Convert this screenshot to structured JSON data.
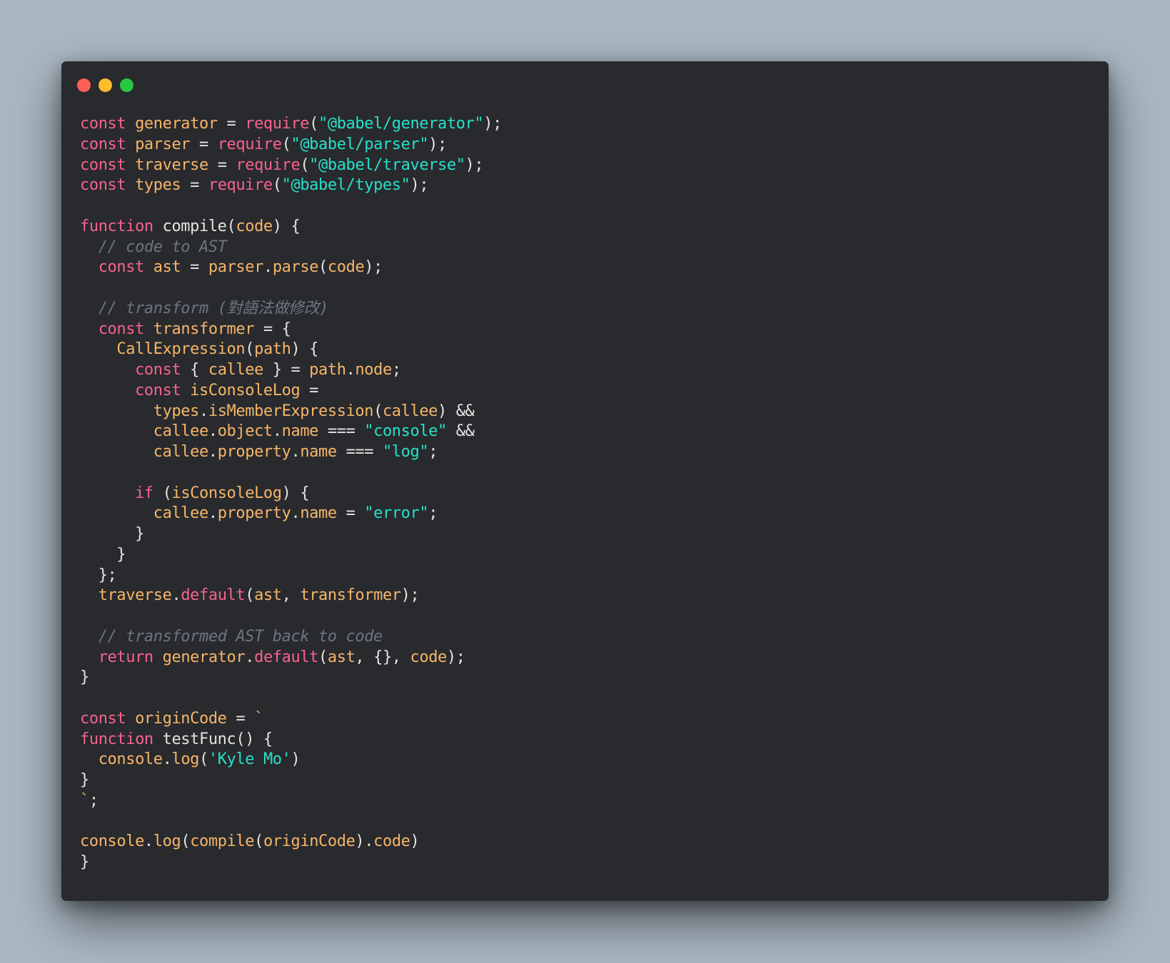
{
  "window": {
    "controls": [
      {
        "name": "close",
        "color": "#fd5f57"
      },
      {
        "name": "minimize",
        "color": "#febc2e"
      },
      {
        "name": "maximize",
        "color": "#28c840"
      }
    ]
  },
  "colors": {
    "background": "#abb8c3",
    "editor_background": "#282a2e",
    "keyword": "#f7628f",
    "identifier": "#f7b568",
    "string": "#27e0c9",
    "plain": "#e4e4e0",
    "comment": "#6e7480"
  },
  "code_lines": [
    [
      [
        "kw",
        "const "
      ],
      [
        "id",
        "generator"
      ],
      [
        "pl",
        " = "
      ],
      [
        "kw",
        "require"
      ],
      [
        "pl",
        "("
      ],
      [
        "str",
        "\"@babel/generator\""
      ],
      [
        "pl",
        ");"
      ]
    ],
    [
      [
        "kw",
        "const "
      ],
      [
        "id",
        "parser"
      ],
      [
        "pl",
        " = "
      ],
      [
        "kw",
        "require"
      ],
      [
        "pl",
        "("
      ],
      [
        "str",
        "\"@babel/parser\""
      ],
      [
        "pl",
        ");"
      ]
    ],
    [
      [
        "kw",
        "const "
      ],
      [
        "id",
        "traverse"
      ],
      [
        "pl",
        " = "
      ],
      [
        "kw",
        "require"
      ],
      [
        "pl",
        "("
      ],
      [
        "str",
        "\"@babel/traverse\""
      ],
      [
        "pl",
        ");"
      ]
    ],
    [
      [
        "kw",
        "const "
      ],
      [
        "id",
        "types"
      ],
      [
        "pl",
        " = "
      ],
      [
        "kw",
        "require"
      ],
      [
        "pl",
        "("
      ],
      [
        "str",
        "\"@babel/types\""
      ],
      [
        "pl",
        ");"
      ]
    ],
    [],
    [
      [
        "kw",
        "function "
      ],
      [
        "fn",
        "compile"
      ],
      [
        "pl",
        "("
      ],
      [
        "id",
        "code"
      ],
      [
        "pl",
        ") {"
      ]
    ],
    [
      [
        "pl",
        "  "
      ],
      [
        "cm",
        "// code to AST"
      ]
    ],
    [
      [
        "pl",
        "  "
      ],
      [
        "kw",
        "const "
      ],
      [
        "id",
        "ast"
      ],
      [
        "pl",
        " = "
      ],
      [
        "id",
        "parser"
      ],
      [
        "pl",
        "."
      ],
      [
        "id",
        "parse"
      ],
      [
        "pl",
        "("
      ],
      [
        "id",
        "code"
      ],
      [
        "pl",
        ");"
      ]
    ],
    [],
    [
      [
        "pl",
        "  "
      ],
      [
        "cm",
        "// transform (對語法做修改)"
      ]
    ],
    [
      [
        "pl",
        "  "
      ],
      [
        "kw",
        "const "
      ],
      [
        "id",
        "transformer"
      ],
      [
        "pl",
        " = {"
      ]
    ],
    [
      [
        "pl",
        "    "
      ],
      [
        "id",
        "CallExpression"
      ],
      [
        "pl",
        "("
      ],
      [
        "id",
        "path"
      ],
      [
        "pl",
        ") {"
      ]
    ],
    [
      [
        "pl",
        "      "
      ],
      [
        "kw",
        "const "
      ],
      [
        "pl",
        "{ "
      ],
      [
        "id",
        "callee"
      ],
      [
        "pl",
        " } = "
      ],
      [
        "id",
        "path"
      ],
      [
        "pl",
        "."
      ],
      [
        "id",
        "node"
      ],
      [
        "pl",
        ";"
      ]
    ],
    [
      [
        "pl",
        "      "
      ],
      [
        "kw",
        "const "
      ],
      [
        "id",
        "isConsoleLog"
      ],
      [
        "pl",
        " ="
      ]
    ],
    [
      [
        "pl",
        "        "
      ],
      [
        "id",
        "types"
      ],
      [
        "pl",
        "."
      ],
      [
        "id",
        "isMemberExpression"
      ],
      [
        "pl",
        "("
      ],
      [
        "id",
        "callee"
      ],
      [
        "pl",
        ") &&"
      ]
    ],
    [
      [
        "pl",
        "        "
      ],
      [
        "id",
        "callee"
      ],
      [
        "pl",
        "."
      ],
      [
        "id",
        "object"
      ],
      [
        "pl",
        "."
      ],
      [
        "id",
        "name"
      ],
      [
        "pl",
        " === "
      ],
      [
        "str",
        "\"console\""
      ],
      [
        "pl",
        " &&"
      ]
    ],
    [
      [
        "pl",
        "        "
      ],
      [
        "id",
        "callee"
      ],
      [
        "pl",
        "."
      ],
      [
        "id",
        "property"
      ],
      [
        "pl",
        "."
      ],
      [
        "id",
        "name"
      ],
      [
        "pl",
        " === "
      ],
      [
        "str",
        "\"log\""
      ],
      [
        "pl",
        ";"
      ]
    ],
    [],
    [
      [
        "pl",
        "      "
      ],
      [
        "kw",
        "if "
      ],
      [
        "pl",
        "("
      ],
      [
        "id",
        "isConsoleLog"
      ],
      [
        "pl",
        ") {"
      ]
    ],
    [
      [
        "pl",
        "        "
      ],
      [
        "id",
        "callee"
      ],
      [
        "pl",
        "."
      ],
      [
        "id",
        "property"
      ],
      [
        "pl",
        "."
      ],
      [
        "id",
        "name"
      ],
      [
        "pl",
        " = "
      ],
      [
        "str",
        "\"error\""
      ],
      [
        "pl",
        ";"
      ]
    ],
    [
      [
        "pl",
        "      }"
      ]
    ],
    [
      [
        "pl",
        "    }"
      ]
    ],
    [
      [
        "pl",
        "  };"
      ]
    ],
    [
      [
        "pl",
        "  "
      ],
      [
        "id",
        "traverse"
      ],
      [
        "pl",
        "."
      ],
      [
        "kw",
        "default"
      ],
      [
        "pl",
        "("
      ],
      [
        "id",
        "ast"
      ],
      [
        "pl",
        ", "
      ],
      [
        "id",
        "transformer"
      ],
      [
        "pl",
        ");"
      ]
    ],
    [],
    [
      [
        "pl",
        "  "
      ],
      [
        "cm",
        "// transformed AST back to code"
      ]
    ],
    [
      [
        "pl",
        "  "
      ],
      [
        "kw",
        "return "
      ],
      [
        "id",
        "generator"
      ],
      [
        "pl",
        "."
      ],
      [
        "kw",
        "default"
      ],
      [
        "pl",
        "("
      ],
      [
        "id",
        "ast"
      ],
      [
        "pl",
        ", {}, "
      ],
      [
        "id",
        "code"
      ],
      [
        "pl",
        ");"
      ]
    ],
    [
      [
        "pl",
        "}"
      ]
    ],
    [],
    [
      [
        "kw",
        "const "
      ],
      [
        "id",
        "originCode"
      ],
      [
        "pl",
        " = "
      ],
      [
        "id",
        "`"
      ]
    ],
    [
      [
        "kw",
        "function "
      ],
      [
        "fn",
        "testFunc"
      ],
      [
        "pl",
        "() {"
      ]
    ],
    [
      [
        "pl",
        "  "
      ],
      [
        "id",
        "console"
      ],
      [
        "pl",
        "."
      ],
      [
        "id",
        "log"
      ],
      [
        "pl",
        "("
      ],
      [
        "str",
        "'Kyle Mo'"
      ],
      [
        "pl",
        ")"
      ]
    ],
    [
      [
        "pl",
        "}"
      ]
    ],
    [
      [
        "id",
        "`"
      ],
      [
        "pl",
        ";"
      ]
    ],
    [],
    [
      [
        "id",
        "console"
      ],
      [
        "pl",
        "."
      ],
      [
        "id",
        "log"
      ],
      [
        "pl",
        "("
      ],
      [
        "id",
        "compile"
      ],
      [
        "pl",
        "("
      ],
      [
        "id",
        "originCode"
      ],
      [
        "pl",
        ")."
      ],
      [
        "id",
        "code"
      ],
      [
        "pl",
        ")"
      ]
    ],
    [
      [
        "pl",
        "}"
      ]
    ]
  ]
}
